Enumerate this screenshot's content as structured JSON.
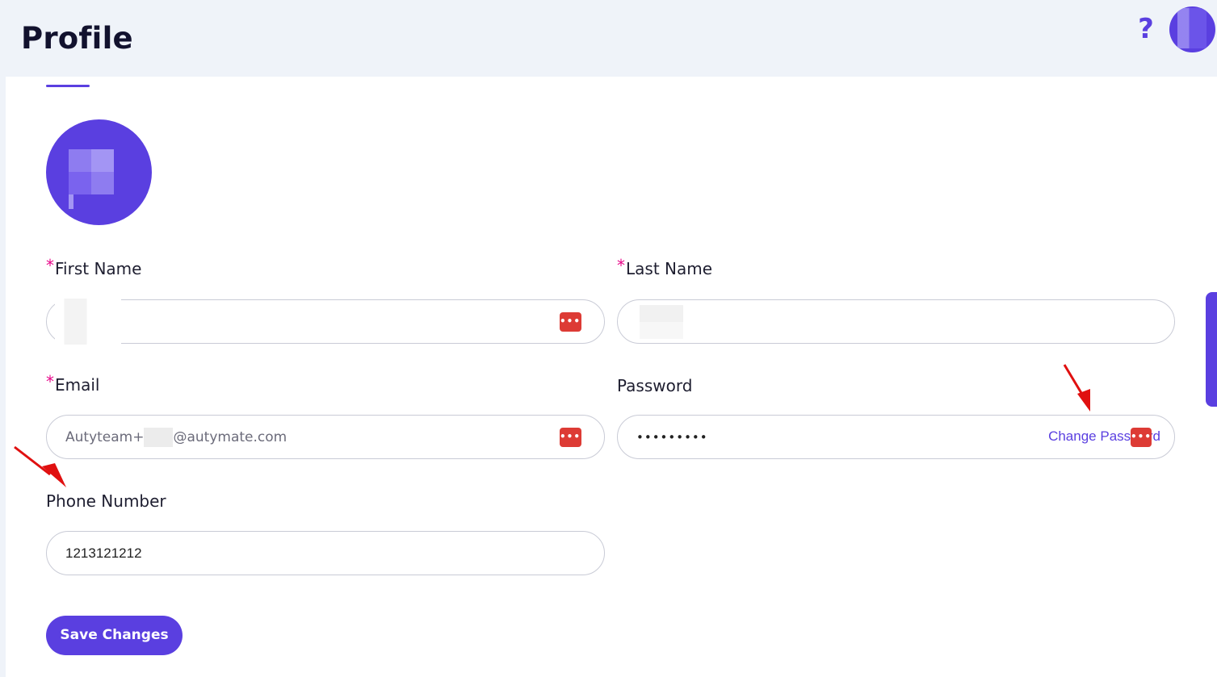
{
  "header": {
    "title": "Profile",
    "help_icon": "question-mark-icon"
  },
  "form": {
    "first_name": {
      "label": "First Name",
      "required": "*",
      "value": ""
    },
    "last_name": {
      "label": "Last Name",
      "required": "*",
      "value": ""
    },
    "email": {
      "label": "Email",
      "required": "*",
      "value_prefix": "Autyteam+",
      "value_suffix": "@autymate.com"
    },
    "password": {
      "label": "Password",
      "value": "•••••••••",
      "change_link": "Change Password"
    },
    "phone": {
      "label": "Phone Number",
      "value": "1213121212"
    }
  },
  "actions": {
    "save_label": "Save Changes"
  },
  "colors": {
    "accent": "#5a3fe0",
    "required": "#e8088a",
    "password_manager": "#dd3b35",
    "annotation_arrow": "#e01010"
  },
  "icons": {
    "password_manager": "password-manager-icon",
    "annotation": "red-arrow-annotation"
  }
}
